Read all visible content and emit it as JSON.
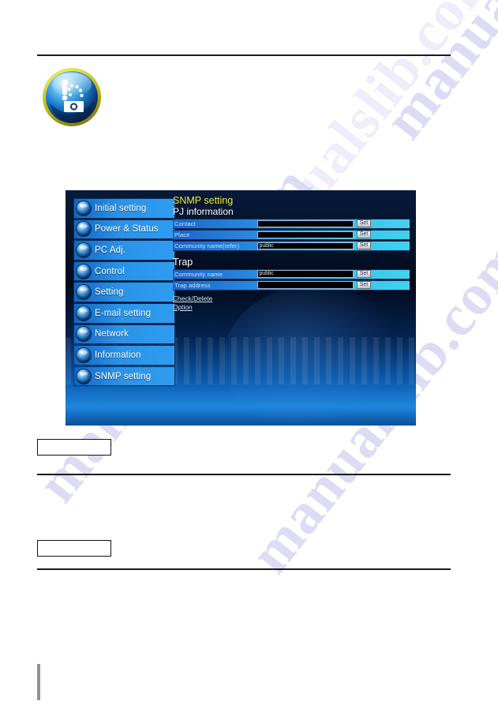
{
  "watermarks": {
    "text_a": "manualslib.com",
    "text_b": "manualslib.com",
    "text_c": "manualslib.com",
    "text_d": "manualslib.com"
  },
  "panel": {
    "sidebar": {
      "items": [
        {
          "label": "Initial setting",
          "icon": "globe-icon"
        },
        {
          "label": "Power & Status",
          "icon": "power-icon"
        },
        {
          "label": "PC Adj.",
          "icon": "monitor-icon"
        },
        {
          "label": "Control",
          "icon": "control-icon"
        },
        {
          "label": "Setting",
          "icon": "wrench-icon"
        },
        {
          "label": "E-mail setting",
          "icon": "envelope-icon"
        },
        {
          "label": "Network",
          "icon": "network-icon"
        },
        {
          "label": "Information",
          "icon": "info-icon"
        },
        {
          "label": "SNMP setting",
          "icon": "snmp-icon"
        }
      ]
    },
    "content": {
      "title": "SNMP setting",
      "subtitle": "PJ information",
      "pj_rows": [
        {
          "label": "Contact",
          "value": "",
          "button": "Set"
        },
        {
          "label": "Place",
          "value": "",
          "button": "Set"
        },
        {
          "label": "Community name(refer)",
          "value": "public",
          "button": "Set"
        }
      ],
      "trap_heading": "Trap",
      "trap_rows": [
        {
          "label": "Community name",
          "value": "public",
          "button": "Set"
        },
        {
          "label": "Trap address",
          "value": "",
          "button": "Set"
        }
      ],
      "links": [
        {
          "label": "Check/Delete"
        },
        {
          "label": "Option"
        }
      ]
    }
  },
  "colors": {
    "title_yellow": "#f2ec3a",
    "nav_blue": "#2a93e8",
    "row_cyan": "#3fd2ee",
    "panel_dark": "#04142c"
  }
}
